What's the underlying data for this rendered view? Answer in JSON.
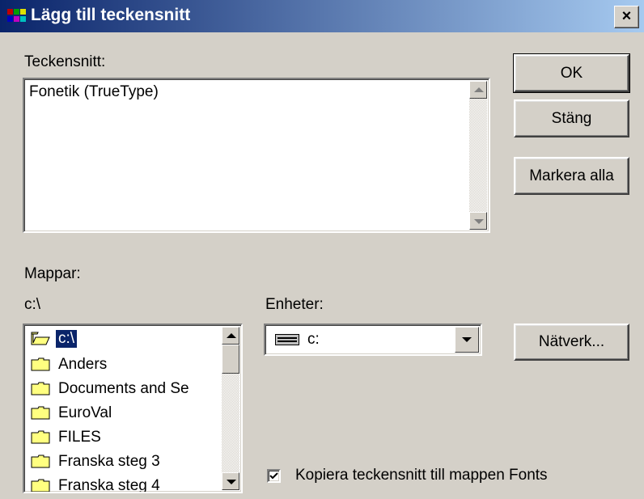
{
  "window": {
    "title": "Lägg till teckensnitt",
    "close_label": "×"
  },
  "fonts_section": {
    "label": "Teckensnitt:",
    "items": [
      "Fonetik (TrueType)"
    ]
  },
  "buttons": {
    "ok": "OK",
    "close": "Stäng",
    "select_all": "Markera alla",
    "network": "Nätverk..."
  },
  "folders_section": {
    "label": "Mappar:",
    "current_path": "c:\\",
    "items": [
      "c:\\",
      "Anders",
      "Documents and Se",
      "EuroVal",
      "FILES",
      "Franska steg 3",
      "Franska steg 4"
    ]
  },
  "drives_section": {
    "label": "Enheter:",
    "selected": "c:"
  },
  "copy_checkbox": {
    "label": "Kopiera teckensnitt till mappen Fonts",
    "checked": true
  },
  "icons": [
    "app-font-icon",
    "open-folder-icon",
    "folder-icon",
    "drive-icon",
    "checkmark-icon",
    "scroll-up-icon",
    "scroll-down-icon",
    "dropdown-arrow-icon"
  ]
}
